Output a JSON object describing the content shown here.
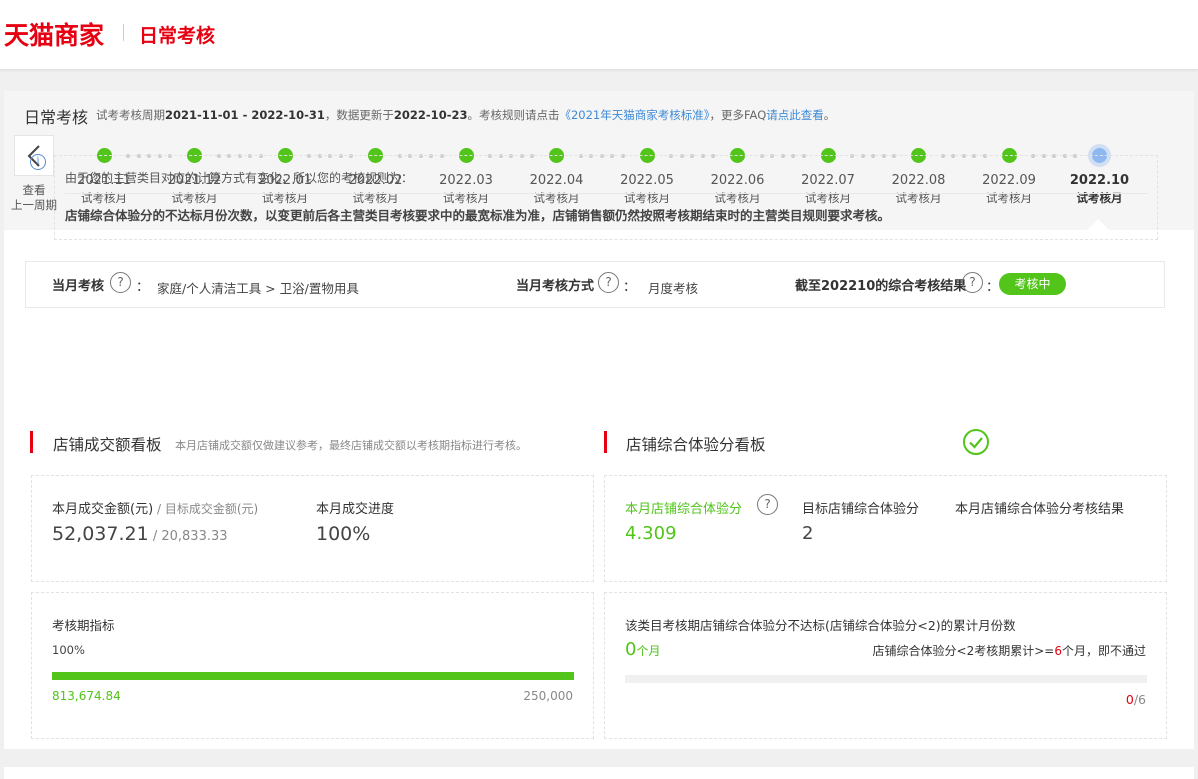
{
  "header": {
    "brand": "天猫商家",
    "page_name": "日常考核"
  },
  "summary": {
    "title": "日常考核",
    "sub_prefix": "试考考核周期",
    "period": "2021-11-01 - 2022-10-31",
    "mid1": "，数据更新于",
    "update_date": "2022-10-23",
    "mid2": "。考核规则请点击",
    "rule_link": "《2021年天猫商家考核标准》",
    "mid3": "，更多FAQ",
    "faq_link": "请点此查看",
    "end": "。"
  },
  "timeline": {
    "prev_label_1": "查看",
    "prev_label_2": "上一周期",
    "nodes": [
      {
        "month": "2021.11",
        "sub": "试考核月"
      },
      {
        "month": "2021.12",
        "sub": "试考核月"
      },
      {
        "month": "2022.01",
        "sub": "试考核月"
      },
      {
        "month": "2022.02",
        "sub": "试考核月"
      },
      {
        "month": "2022.03",
        "sub": "试考核月"
      },
      {
        "month": "2022.04",
        "sub": "试考核月"
      },
      {
        "month": "2022.05",
        "sub": "试考核月"
      },
      {
        "month": "2022.06",
        "sub": "试考核月"
      },
      {
        "month": "2022.07",
        "sub": "试考核月"
      },
      {
        "month": "2022.08",
        "sub": "试考核月"
      },
      {
        "month": "2022.09",
        "sub": "试考核月"
      },
      {
        "month": "2022.10",
        "sub": "试考核月"
      }
    ],
    "current_index": 11
  },
  "notice": {
    "icon": "info-icon",
    "line1": "由于您的主营类目对应的计算方式有变化，所以您的考核规则为：",
    "line2": "店铺综合体验分的不达标月份次数，以变更前后各主营类目考核要求中的最宽标准为准，店铺销售额仍然按照考核期结束时的主营类目规则要求考核。"
  },
  "info": {
    "month_label": "当月考核",
    "month_value": "家庭/个人清洁工具 > 卫浴/置物用具",
    "method_label": "当月考核方式",
    "method_value": "月度考核",
    "result_label": "截至202210的综合考核结果",
    "result_value": "考核中",
    "colon": "：",
    "qmark": "?"
  },
  "sales_board": {
    "title": "店铺成交额看板",
    "note": "本月店铺成交额仅做建议参考，最终店铺成交额以考核期指标进行考核。",
    "amount_label": "本月成交金额(元)",
    "amount_sep": " / ",
    "target_label": "目标成交金额(元)",
    "amount": "52,037.21",
    "target": "20,833.33",
    "progress_label": "本月成交进度",
    "progress": "100%",
    "period_label": "考核期指标",
    "period_percent": "100%",
    "period_fill": 1.0,
    "period_actual": "813,674.84",
    "period_target": "250,000"
  },
  "exp_board": {
    "title": "店铺综合体验分看板",
    "score_label": "本月店铺综合体验分",
    "score": "4.309",
    "target_label": "目标店铺综合体验分",
    "target": "2",
    "result_label": "本月店铺综合体验分考核结果",
    "result_icon": "check-circle-icon",
    "fail_title": "该类目考核期店铺综合体验分不达标(店铺综合体验分<2)的累计月份数",
    "fail_count": "0",
    "fail_unit": "个月",
    "rule_prefix": "店铺综合体验分<2考核期累计>=",
    "rule_num": "6",
    "rule_suffix": "个月，即不通过",
    "fail_fill": 0,
    "count_cur": "0",
    "count_total": "/6"
  },
  "colors": {
    "brand": "#e60012",
    "green": "#52c41a",
    "link": "#3d8ad6",
    "current_dot": "#8fb7f0"
  }
}
